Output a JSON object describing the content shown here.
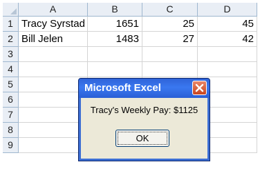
{
  "sheet": {
    "columns": [
      "A",
      "B",
      "C",
      "D"
    ],
    "rows": [
      "1",
      "2",
      "3",
      "4",
      "5",
      "6",
      "7",
      "8",
      "9"
    ],
    "data": [
      [
        "Tracy Syrstad",
        "1651",
        "25",
        "45"
      ],
      [
        "Bill Jelen",
        "1483",
        "27",
        "42"
      ]
    ]
  },
  "dialog": {
    "title": "Microsoft Excel",
    "message": "Tracy's Weekly Pay: $1125",
    "ok_label": "OK",
    "close_icon": "close-icon"
  }
}
